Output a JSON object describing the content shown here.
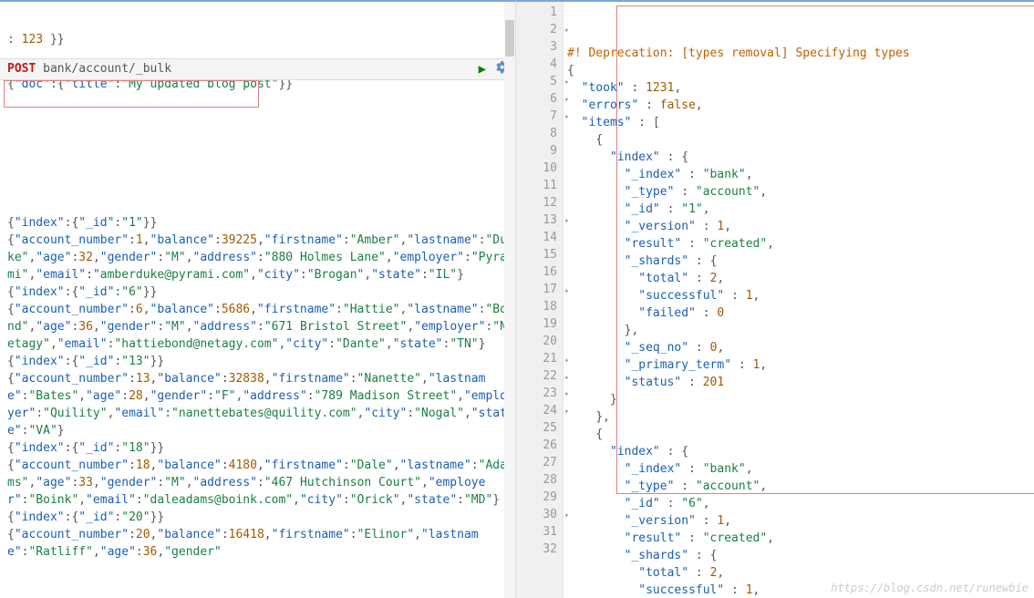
{
  "left": {
    "line0a": ": 123 }}",
    "doc_line": "{\"doc\":{\"title\":\"My updated blog post\"}}",
    "request": {
      "method": "POST",
      "path": "bank/account/_bulk"
    },
    "bulk": [
      "{\"index\":{\"_id\":\"1\"}}",
      "{\"account_number\":1,\"balance\":39225,\"firstname\":\"Amber\",\"lastname\":\"Duke\",\"age\":32,\"gender\":\"M\",\"address\":\"880 Holmes Lane\",\"employer\":\"Pyrami\",\"email\":\"amberduke@pyrami.com\",\"city\":\"Brogan\",\"state\":\"IL\"}",
      "{\"index\":{\"_id\":\"6\"}}",
      "{\"account_number\":6,\"balance\":5686,\"firstname\":\"Hattie\",\"lastname\":\"Bond\",\"age\":36,\"gender\":\"M\",\"address\":\"671 Bristol Street\",\"employer\":\"Netagy\",\"email\":\"hattiebond@netagy.com\",\"city\":\"Dante\",\"state\":\"TN\"}",
      "{\"index\":{\"_id\":\"13\"}}",
      "{\"account_number\":13,\"balance\":32838,\"firstname\":\"Nanette\",\"lastname\":\"Bates\",\"age\":28,\"gender\":\"F\",\"address\":\"789 Madison Street\",\"employer\":\"Quility\",\"email\":\"nanettebates@quility.com\",\"city\":\"Nogal\",\"state\":\"VA\"}",
      "{\"index\":{\"_id\":\"18\"}}",
      "{\"account_number\":18,\"balance\":4180,\"firstname\":\"Dale\",\"lastname\":\"Adams\",\"age\":33,\"gender\":\"M\",\"address\":\"467 Hutchinson Court\",\"employer\":\"Boink\",\"email\":\"daleadams@boink.com\",\"city\":\"Orick\",\"state\":\"MD\"}",
      "{\"index\":{\"_id\":\"20\"}}",
      "{\"account_number\":20,\"balance\":16418,\"firstname\":\"Elinor\",\"lastname\":\"Ratliff\",\"age\":36,\"gender\""
    ]
  },
  "right": {
    "deprecation": "#! Deprecation: [types removal] Specifying types",
    "lines": [
      "{",
      "  \"took\" : 1231,",
      "  \"errors\" : false,",
      "  \"items\" : [",
      "    {",
      "      \"index\" : {",
      "        \"_index\" : \"bank\",",
      "        \"_type\" : \"account\",",
      "        \"_id\" : \"1\",",
      "        \"_version\" : 1,",
      "        \"result\" : \"created\",",
      "        \"_shards\" : {",
      "          \"total\" : 2,",
      "          \"successful\" : 1,",
      "          \"failed\" : 0",
      "        },",
      "        \"_seq_no\" : 0,",
      "        \"_primary_term\" : 1,",
      "        \"status\" : 201",
      "      }",
      "    },",
      "    {",
      "      \"index\" : {",
      "        \"_index\" : \"bank\",",
      "        \"_type\" : \"account\",",
      "        \"_id\" : \"6\",",
      "        \"_version\" : 1,",
      "        \"result\" : \"created\",",
      "        \"_shards\" : {",
      "          \"total\" : 2,",
      "          \"successful\" : 1,"
    ],
    "line_numbers_start": 1,
    "fold_open_lines": [
      2,
      5,
      6,
      7,
      13,
      23,
      24,
      30
    ],
    "fold_close_lines": [
      17,
      21,
      22
    ]
  },
  "watermark": "https://blog.csdn.net/runewbie"
}
